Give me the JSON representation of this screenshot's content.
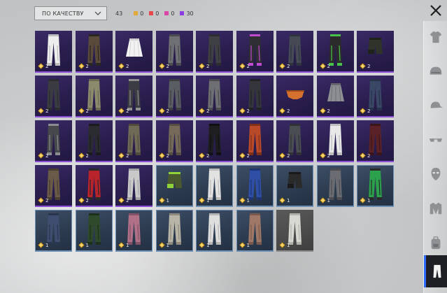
{
  "sort": {
    "label": "ПО КАЧЕСТВУ"
  },
  "counts": {
    "total": "43",
    "items": [
      {
        "name": "gold",
        "color": "#e0a93a",
        "value": "0"
      },
      {
        "name": "red",
        "color": "#e5484d",
        "value": "0"
      },
      {
        "name": "pink",
        "color": "#d946a8",
        "value": "0"
      },
      {
        "name": "purple",
        "color": "#8b3fe0",
        "value": "30"
      }
    ]
  },
  "colors": {
    "accent": "#2f6bff",
    "purple_rarity": "#8a4fd6",
    "blue_rarity": "#6d8fb5"
  },
  "sidebar": {
    "items": [
      {
        "name": "top-icon"
      },
      {
        "name": "helmet-icon"
      },
      {
        "name": "cap-icon"
      },
      {
        "name": "glasses-icon"
      },
      {
        "name": "mask-icon"
      },
      {
        "name": "jacket-icon"
      },
      {
        "name": "backpack-icon"
      },
      {
        "name": "pants-icon"
      }
    ],
    "active": "pants-icon"
  },
  "items": [
    {
      "rarity": "purple",
      "count": "2",
      "color": "#eeeeee",
      "accent": "#bdbdbd",
      "shape": "pants"
    },
    {
      "rarity": "purple",
      "count": "2",
      "color": "#5a4a3a",
      "accent": "#2a2622",
      "shape": "pants"
    },
    {
      "rarity": "purple",
      "count": "2",
      "color": "#f2f2f2",
      "accent": "#cfcfcf",
      "shape": "skirt"
    },
    {
      "rarity": "purple",
      "count": "2",
      "color": "#6f7073",
      "accent": "#4a4b4e",
      "shape": "pants"
    },
    {
      "rarity": "purple",
      "count": "2",
      "color": "#3f4044",
      "accent": "#2c2d30",
      "shape": "pants"
    },
    {
      "rarity": "purple",
      "count": "2",
      "color": "#2e2e33",
      "accent": "#c04ad0",
      "shape": "pants"
    },
    {
      "rarity": "purple",
      "count": "2",
      "color": "#464a55",
      "accent": "#2f3340",
      "shape": "pants"
    },
    {
      "rarity": "purple",
      "count": "2",
      "color": "#2b2b2b",
      "accent": "#49c24a",
      "shape": "pants"
    },
    {
      "rarity": "purple",
      "count": "2",
      "color": "#2f3329",
      "accent": "#1f221b",
      "shape": "shorts"
    },
    {
      "rarity": "purple",
      "count": "2",
      "color": "#3a3c42",
      "accent": "#2a2c30",
      "shape": "pants"
    },
    {
      "rarity": "purple",
      "count": "2",
      "color": "#8c8a6c",
      "accent": "#6a6850",
      "shape": "pants"
    },
    {
      "rarity": "purple",
      "count": "2",
      "color": "#3b3d42",
      "accent": "#8f8f8f",
      "shape": "pants"
    },
    {
      "rarity": "purple",
      "count": "2",
      "color": "#5a5d62",
      "accent": "#3c3e42",
      "shape": "pants"
    },
    {
      "rarity": "purple",
      "count": "2",
      "color": "#6e6f73",
      "accent": "#4a4b4f",
      "shape": "pants"
    },
    {
      "rarity": "purple",
      "count": "2",
      "color": "#34363b",
      "accent": "#202226",
      "shape": "pants"
    },
    {
      "rarity": "purple",
      "count": "2",
      "color": "#d5712f",
      "accent": "#9c4c1a",
      "shape": "briefs"
    },
    {
      "rarity": "purple",
      "count": "2",
      "color": "#8d8f93",
      "accent": "#66686c",
      "shape": "skirt"
    },
    {
      "rarity": "purple",
      "count": "2",
      "color": "#3a4866",
      "accent": "#27324a",
      "shape": "pants"
    },
    {
      "rarity": "purple",
      "count": "2",
      "color": "#46484c",
      "accent": "#8a8c90",
      "shape": "pants"
    },
    {
      "rarity": "purple",
      "count": "2",
      "color": "#2a2c2f",
      "accent": "#1a1b1d",
      "shape": "pants"
    },
    {
      "rarity": "purple",
      "count": "2",
      "color": "#6e6a55",
      "accent": "#4f4c3d",
      "shape": "pants"
    },
    {
      "rarity": "purple",
      "count": "2",
      "color": "#756a5a",
      "accent": "#574e42",
      "shape": "pants"
    },
    {
      "rarity": "purple",
      "count": "2",
      "color": "#1e1e20",
      "accent": "#101012",
      "shape": "pants"
    },
    {
      "rarity": "purple",
      "count": "2",
      "color": "#b84a2a",
      "accent": "#7f3018",
      "shape": "pants"
    },
    {
      "rarity": "purple",
      "count": "2",
      "color": "#4a4d52",
      "accent": "#2f3135",
      "shape": "pants"
    },
    {
      "rarity": "purple",
      "count": "2",
      "color": "#e8e8e8",
      "accent": "#bdbdbd",
      "shape": "pants"
    },
    {
      "rarity": "purple",
      "count": "2",
      "color": "#5a2226",
      "accent": "#3b1518",
      "shape": "pants"
    },
    {
      "rarity": "purple",
      "count": "2",
      "color": "#6a5a48",
      "accent": "#4a3e31",
      "shape": "pants"
    },
    {
      "rarity": "purple",
      "count": "2",
      "color": "#b8242a",
      "accent": "#2a2a2a",
      "shape": "pants"
    },
    {
      "rarity": "purple",
      "count": "2",
      "color": "#c9c9c9",
      "accent": "#a3a3a3",
      "shape": "pants"
    },
    {
      "rarity": "blue",
      "count": "1",
      "color": "#4a5a2e",
      "accent": "#8fd23a",
      "shape": "shorts"
    },
    {
      "rarity": "blue",
      "count": "1",
      "color": "#e2e2e2",
      "accent": "#bcbcbc",
      "shape": "pants"
    },
    {
      "rarity": "blue",
      "count": "1",
      "color": "#2f4fa6",
      "accent": "#1f3574",
      "shape": "pants"
    },
    {
      "rarity": "blue",
      "count": "1",
      "color": "#2a2a2a",
      "accent": "#1a1a1a",
      "shape": "shorts"
    },
    {
      "rarity": "blue",
      "count": "1",
      "color": "#6a6c72",
      "accent": "#4b4d52",
      "shape": "pants"
    },
    {
      "rarity": "blue",
      "count": "1",
      "color": "#2aa14a",
      "accent": "#2a2a2a",
      "shape": "pants"
    },
    {
      "rarity": "blue",
      "count": "1",
      "color": "#3f4e70",
      "accent": "#2a354d",
      "shape": "pants"
    },
    {
      "rarity": "blue",
      "count": "1",
      "color": "#2f4a2a",
      "accent": "#1e301b",
      "shape": "pants"
    },
    {
      "rarity": "blue",
      "count": "1",
      "color": "#b07088",
      "accent": "#845266",
      "shape": "pants"
    },
    {
      "rarity": "blue",
      "count": "1",
      "color": "#b8b4a6",
      "accent": "#8e8a7e",
      "shape": "pants"
    },
    {
      "rarity": "blue",
      "count": "1",
      "color": "#dedede",
      "accent": "#b5b5b5",
      "shape": "pants"
    },
    {
      "rarity": "blue",
      "count": "1",
      "color": "#a07868",
      "accent": "#7a594c",
      "shape": "pants"
    },
    {
      "rarity": "gray",
      "count": "1",
      "color": "#d8d8d2",
      "accent": "#b2b2ac",
      "shape": "pants"
    }
  ]
}
